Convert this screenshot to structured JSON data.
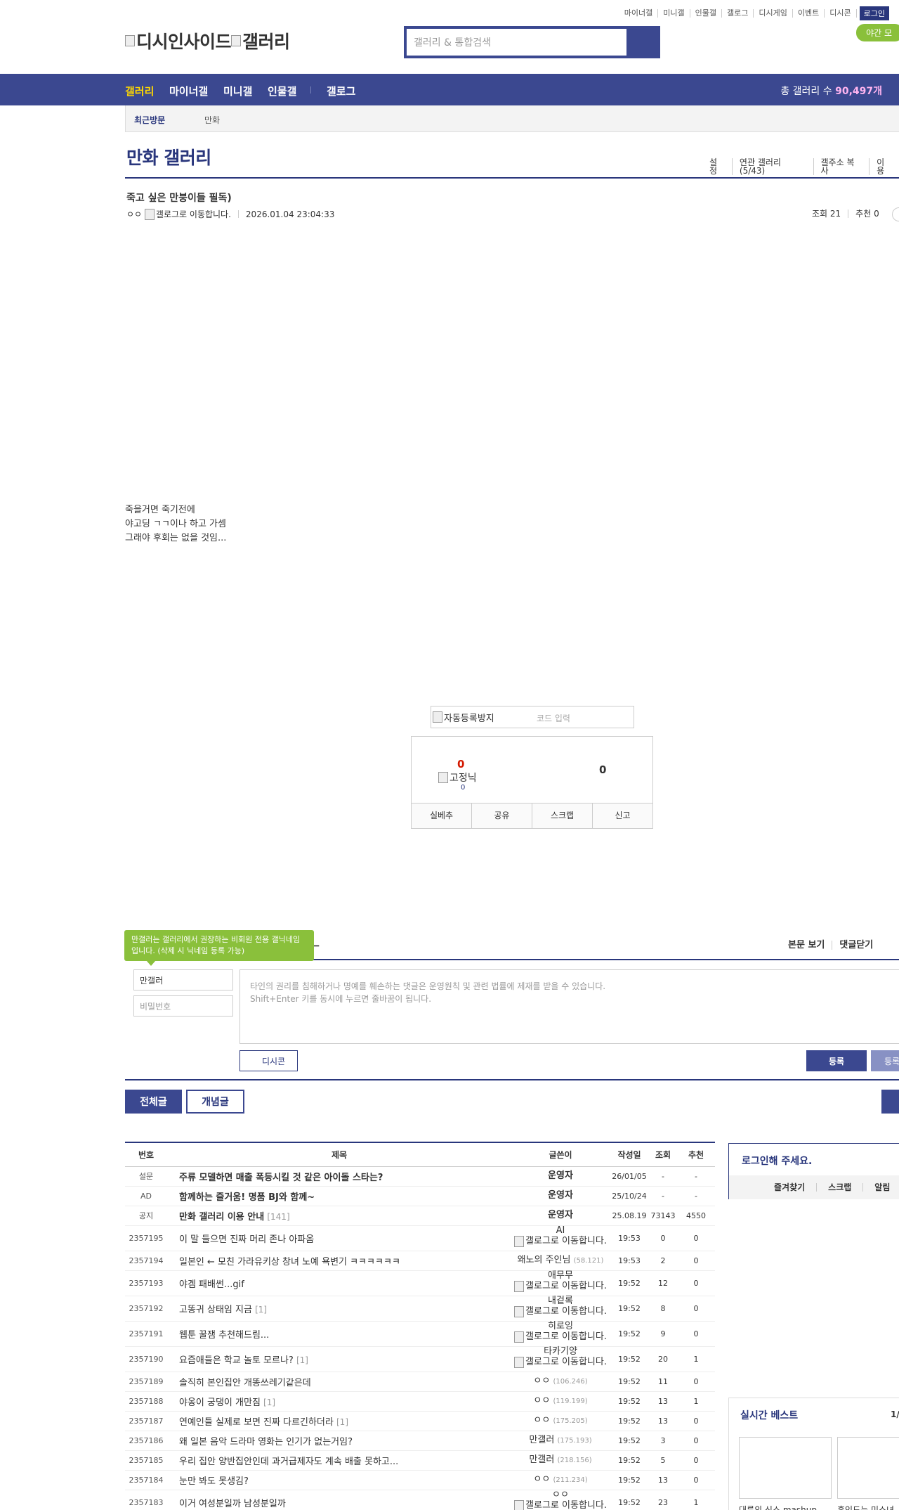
{
  "top_links": [
    "마이너갤",
    "미니갤",
    "인물갤",
    "갤로그",
    "디시게임",
    "이벤트",
    "디시콘"
  ],
  "login_label": "로그인",
  "night_mode": "야간 모",
  "logo": {
    "part1": "디시인사이드",
    "part2": "갤러리"
  },
  "search": {
    "placeholder": "갤러리 & 통합검색"
  },
  "gnb": {
    "items": [
      "갤러리",
      "마이너갤",
      "미니갤",
      "인물갤",
      "갤로그"
    ],
    "total_prefix": "총 갤러리 수 ",
    "total_value": "90,497개"
  },
  "visit": {
    "label": "최근방문",
    "item": "만화"
  },
  "gallery": {
    "title": "만화 갤러리",
    "tools": [
      "설정",
      "연관 갤러리(5/43)",
      "갤주소 복사",
      "이용"
    ]
  },
  "post": {
    "title": "죽고 싶은 만붕이들 필독)",
    "author": "ㅇㅇ",
    "author_img_alt": "갤로그로 이동합니다.",
    "date": "2026.01.04 23:04:33",
    "views": "조회 21",
    "recommends": "추천 0",
    "body": [
      "죽을거면 죽기전에",
      "야고딩 ㄱㄱ이나 하고 가셈",
      "그래야 후회는 없을 것임..."
    ]
  },
  "captcha": {
    "img_alt": "자동등록방지",
    "placeholder": "코드 입력"
  },
  "recommend": {
    "up_count": "0",
    "fixed_alt": "고정닉",
    "fixed_count": "0",
    "down_count": "0",
    "actions": [
      "실베추",
      "공유",
      "스크랩",
      "신고"
    ]
  },
  "comment": {
    "title_frag": "ㅡ",
    "tools": [
      "본문 보기",
      "댓글닫기"
    ],
    "tooltip": "만갤러는 갤러리에서 권장하는 비회원 전용 갤닉네임입니다. (삭제 시 닉네임 등록 가능)",
    "name_value": "만갤러",
    "pw_placeholder": "비밀번호",
    "textarea_line1": "타인의 권리를 침해하거나 명예를 훼손하는 댓글은 운영원칙 및 관련 법률에 제재를 받을 수 있습니다.",
    "textarea_line2": "Shift+Enter 키를 동시에 누르면 줄바꿈이 됩니다.",
    "dccon": "디시콘",
    "submit": "등록",
    "submit2": "등록"
  },
  "tabs": {
    "all": "전체글",
    "concept": "개념글"
  },
  "list": {
    "headers": [
      "번호",
      "제목",
      "글쓴이",
      "작성일",
      "조회",
      "추천"
    ],
    "rows": [
      {
        "num": "설문",
        "subject": "주류 모델하면 매출 폭등시킬 것 같은 아이돌 스타는?",
        "bold": true,
        "reply": "",
        "writer": "운영자",
        "writer_bold": true,
        "ip": "",
        "img": false,
        "date": "26/01/05",
        "view": "-",
        "rec": "-"
      },
      {
        "num": "AD",
        "subject": "함께하는 즐거움! 명품 BJ와 함께~",
        "bold": true,
        "reply": "",
        "writer": "운영자",
        "writer_bold": true,
        "ip": "",
        "img": false,
        "date": "25/10/24",
        "view": "-",
        "rec": "-"
      },
      {
        "num": "공지",
        "subject": "만화 갤러리 이용 안내",
        "bold": true,
        "reply": "[141]",
        "writer": "운영자",
        "writer_bold": true,
        "ip": "",
        "img": false,
        "date": "25.08.19",
        "view": "73143",
        "rec": "4550"
      },
      {
        "num": "2357195",
        "subject": "이 말 들으면 진짜 머리 존나 아파옴",
        "bold": false,
        "reply": "",
        "writer": "AI",
        "writer_bold": false,
        "ip": "",
        "img": true,
        "date": "19:53",
        "view": "0",
        "rec": "0"
      },
      {
        "num": "2357194",
        "subject": "일본인 ← 모친 가라유키상 창녀 노예 욕변기 ㅋㅋㅋㅋㅋㅋ",
        "bold": false,
        "reply": "",
        "writer": "왜노의 주인님",
        "writer_bold": false,
        "ip": "(58.121)",
        "img": false,
        "date": "19:53",
        "view": "2",
        "rec": "0"
      },
      {
        "num": "2357193",
        "subject": "야겜 패배썬...gif",
        "bold": false,
        "reply": "",
        "writer": "애무무",
        "writer_bold": false,
        "ip": "",
        "img": true,
        "date": "19:52",
        "view": "12",
        "rec": "0"
      },
      {
        "num": "2357192",
        "subject": "고똥귀 상태임 지금",
        "bold": false,
        "reply": "[1]",
        "writer": "내겉록",
        "writer_bold": false,
        "ip": "",
        "img": true,
        "date": "19:52",
        "view": "8",
        "rec": "0"
      },
      {
        "num": "2357191",
        "subject": "웹툰 꿀잼 추천해드림...",
        "bold": false,
        "reply": "",
        "writer": "히로잉",
        "writer_bold": false,
        "ip": "",
        "img": true,
        "date": "19:52",
        "view": "9",
        "rec": "0"
      },
      {
        "num": "2357190",
        "subject": "요즘애들은 학교 놀토 모르나?",
        "bold": false,
        "reply": "[1]",
        "writer": "타카기양",
        "writer_bold": false,
        "ip": "",
        "img": true,
        "date": "19:52",
        "view": "20",
        "rec": "1"
      },
      {
        "num": "2357189",
        "subject": "솔직히 본인집안 개똥쓰레기같은데",
        "bold": false,
        "reply": "",
        "writer": "ㅇㅇ",
        "writer_bold": false,
        "ip": "(106.246)",
        "img": false,
        "date": "19:52",
        "view": "11",
        "rec": "0"
      },
      {
        "num": "2357188",
        "subject": "야옹이 궁댕이 개만짐",
        "bold": false,
        "reply": "[1]",
        "writer": "ㅇㅇ",
        "writer_bold": false,
        "ip": "(119.199)",
        "img": false,
        "date": "19:52",
        "view": "13",
        "rec": "1"
      },
      {
        "num": "2357187",
        "subject": "연예인들 실제로 보면 진짜 다르긴하더라",
        "bold": false,
        "reply": "[1]",
        "writer": "ㅇㅇ",
        "writer_bold": false,
        "ip": "(175.205)",
        "img": false,
        "date": "19:52",
        "view": "13",
        "rec": "0"
      },
      {
        "num": "2357186",
        "subject": "왜 일본 음악 드라마 영화는 인기가 없는거임?",
        "bold": false,
        "reply": "",
        "writer": "만갤러",
        "writer_bold": false,
        "ip": "(175.193)",
        "img": false,
        "date": "19:52",
        "view": "3",
        "rec": "0"
      },
      {
        "num": "2357185",
        "subject": "우리 집안 양반집안인데 과거급제자도 계속 배출 못하고...",
        "bold": false,
        "reply": "",
        "writer": "만갤러",
        "writer_bold": false,
        "ip": "(218.156)",
        "img": false,
        "date": "19:52",
        "view": "5",
        "rec": "0"
      },
      {
        "num": "2357184",
        "subject": "눈만 봐도 못생김?",
        "bold": false,
        "reply": "",
        "writer": "ㅇㅇ",
        "writer_bold": false,
        "ip": "(211.234)",
        "img": false,
        "date": "19:52",
        "view": "13",
        "rec": "0"
      },
      {
        "num": "2357183",
        "subject": "이거 여성분일까 남성분일까",
        "bold": false,
        "reply": "",
        "writer": "ㅇㅇ",
        "writer_bold": false,
        "ip": "",
        "img": true,
        "date": "19:52",
        "view": "23",
        "rec": "1"
      }
    ],
    "writer_img_alt": "갤로그로 이동합니다."
  },
  "login_box": {
    "title": "로그인해 주세요.",
    "links": [
      "즐겨찾기",
      "스크랩",
      "알림"
    ]
  },
  "best": {
    "title": "실시간 베스트",
    "page": "1/",
    "cap1": "대륙의 신스 mashup",
    "cap2": "혼인도는 미소녀"
  }
}
